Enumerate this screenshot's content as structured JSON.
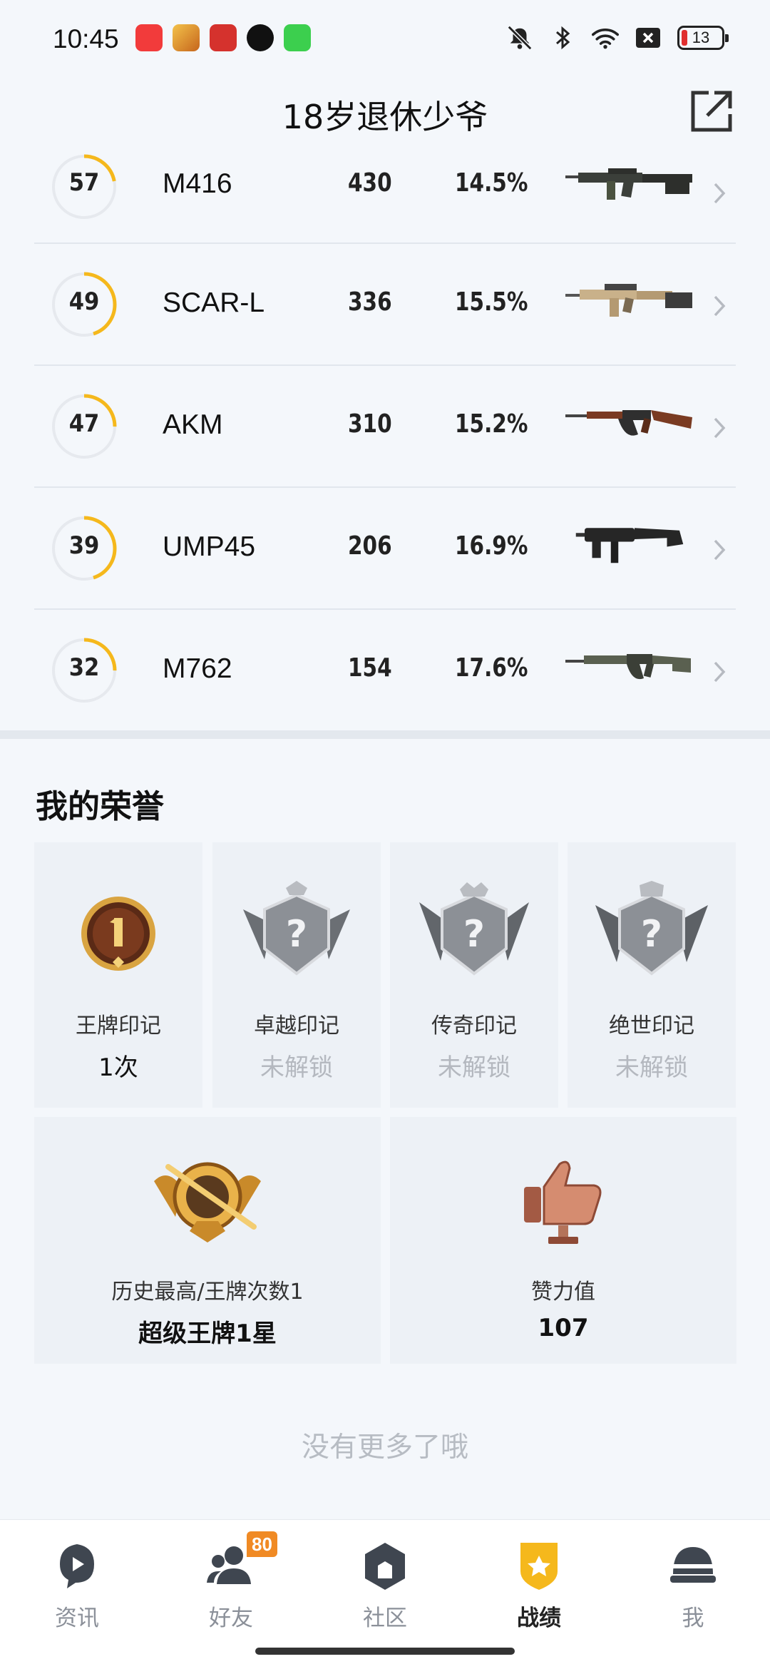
{
  "status_bar": {
    "time": "10:45",
    "battery": "13",
    "app_icons": [
      "music-app-icon",
      "game-app-icon",
      "store-app-icon",
      "tiktok-app-icon",
      "messages-app-icon"
    ],
    "system_icons": [
      "mute-icon",
      "bluetooth-icon",
      "wifi-icon",
      "sim-off-icon"
    ]
  },
  "header": {
    "title": "18岁退休少爷",
    "share_icon": "external-link-icon"
  },
  "weapons": [
    {
      "level": "57",
      "ring_fraction": 0.22,
      "name": "M416",
      "count": "430",
      "pct": "14.5%"
    },
    {
      "level": "49",
      "ring_fraction": 0.45,
      "name": "SCAR-L",
      "count": "336",
      "pct": "15.5%"
    },
    {
      "level": "47",
      "ring_fraction": 0.25,
      "name": "AKM",
      "count": "310",
      "pct": "15.2%"
    },
    {
      "level": "39",
      "ring_fraction": 0.45,
      "name": "UMP45",
      "count": "206",
      "pct": "16.9%"
    },
    {
      "level": "32",
      "ring_fraction": 0.25,
      "name": "M762",
      "count": "154",
      "pct": "17.6%"
    }
  ],
  "honors": {
    "title": "我的荣誉",
    "marks": [
      {
        "label": "王牌印记",
        "value": "1次",
        "locked": false
      },
      {
        "label": "卓越印记",
        "value": "未解锁",
        "locked": true
      },
      {
        "label": "传奇印记",
        "value": "未解锁",
        "locked": true
      },
      {
        "label": "绝世印记",
        "value": "未解锁",
        "locked": true
      }
    ],
    "highest": {
      "label": "历史最高/王牌次数1",
      "value": "超级王牌1星"
    },
    "likes": {
      "label": "赞力值",
      "value": "107"
    }
  },
  "footer_note": "没有更多了哦",
  "bottom_nav": {
    "items": [
      {
        "label": "资讯",
        "icon": "news-icon",
        "active": false
      },
      {
        "label": "好友",
        "icon": "friends-icon",
        "active": false,
        "badge": "80"
      },
      {
        "label": "社区",
        "icon": "community-icon",
        "active": false
      },
      {
        "label": "战绩",
        "icon": "record-icon",
        "active": true
      },
      {
        "label": "我",
        "icon": "helmet-icon",
        "active": false
      }
    ]
  },
  "colors": {
    "accent": "#f5b81c",
    "ring_track": "#e6e9ee",
    "locked_text": "#b4b8bf"
  }
}
